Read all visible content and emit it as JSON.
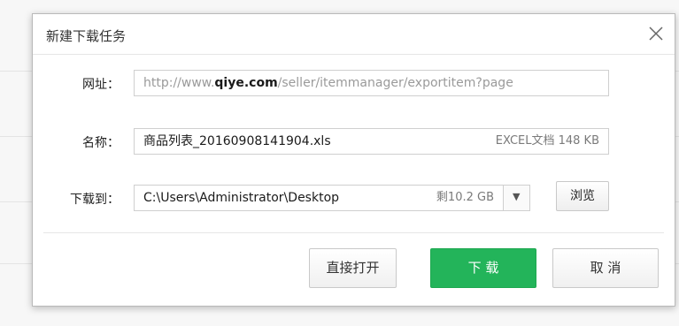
{
  "dialog": {
    "title": "新建下载任务",
    "close_icon": "close-icon"
  },
  "url_row": {
    "label": "网址：",
    "prefix": "http://www.",
    "domain": "qiye.com",
    "path": "/seller/itemmanager/exportitem?page"
  },
  "name_row": {
    "label": "名称：",
    "filename": "商品列表_20160908141904.xls",
    "meta": "EXCEL文档 148 KB"
  },
  "save_row": {
    "label": "下载到：",
    "path": "C:\\Users\\Administrator\\Desktop",
    "free_space": "剩10.2 GB",
    "dropdown_icon": "chevron-down-icon",
    "dropdown_glyph": "▼",
    "browse_label": "浏览"
  },
  "buttons": {
    "open_label": "直接打开",
    "download_label": "下 载",
    "cancel_label": "取 消"
  },
  "colors": {
    "accent_green": "#23b45a",
    "link_blue": "#2d62c8"
  }
}
